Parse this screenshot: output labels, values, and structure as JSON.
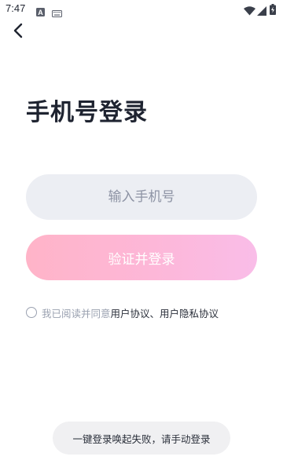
{
  "status_bar": {
    "time": "7:47",
    "left_icons": [
      "a-notification-icon",
      "keyboard-icon"
    ],
    "right_icons": [
      "wifi-icon",
      "signal-icon",
      "battery-charging-icon"
    ]
  },
  "nav": {
    "back_icon": "chevron-left-icon"
  },
  "page": {
    "title": "手机号登录"
  },
  "phone_input": {
    "placeholder": "输入手机号",
    "value": ""
  },
  "login_button": {
    "label": "验证并登录",
    "color_start": "#ffb4c8",
    "color_end": "#f9bde8"
  },
  "agreement": {
    "checked": false,
    "prefix": "我已阅读并同意",
    "user_agreement": "用户协议",
    "separator": "、",
    "privacy_agreement": "用户隐私协议"
  },
  "toast": {
    "message": "一键登录唤起失败，请手动登录"
  }
}
